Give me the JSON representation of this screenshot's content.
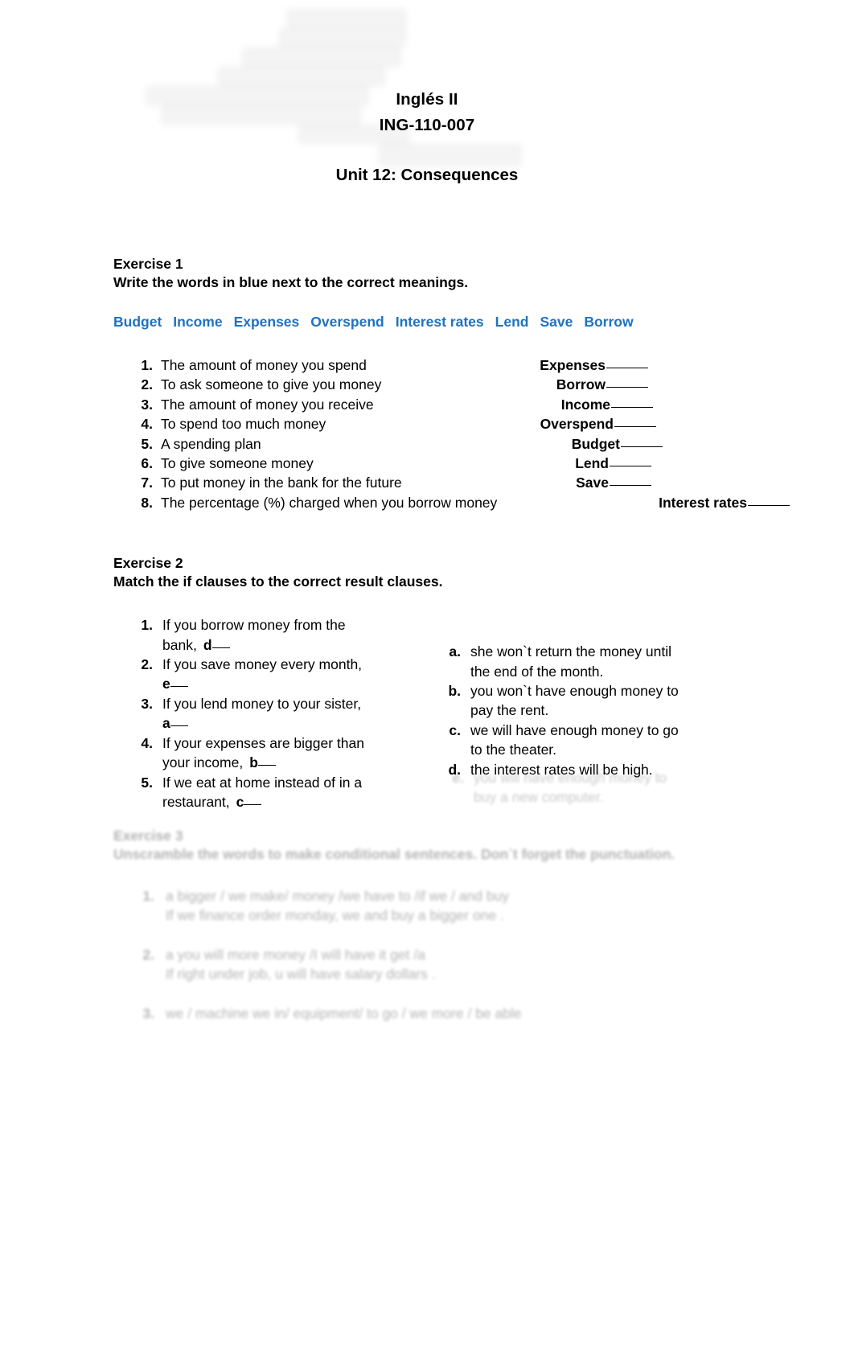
{
  "document": {
    "course_title": "Inglés II",
    "course_code": "ING-110-007",
    "unit_title": "Unit 12: Consequences"
  },
  "colors": {
    "word_bank_blue": "#1F72C0",
    "text_black": "#000000",
    "page_background": "#FFFFFF"
  },
  "exercise1": {
    "heading": "Exercise 1",
    "instructions": "Write the words in blue next to the correct meanings.",
    "word_bank": [
      "Budget",
      "Income",
      "Expenses",
      "Overspend",
      "Interest rates",
      "Lend",
      "Save",
      "Borrow"
    ],
    "items": [
      {
        "number": "1.",
        "definition": "The amount of money you spend",
        "answer": "Expenses"
      },
      {
        "number": "2.",
        "definition": "To ask someone to give you money",
        "answer": "Borrow"
      },
      {
        "number": "3.",
        "definition": "The amount of money you receive",
        "answer": "Income"
      },
      {
        "number": "4.",
        "definition": "To spend too much money",
        "answer": "Overspend"
      },
      {
        "number": "5.",
        "definition": "A spending plan",
        "answer": "Budget"
      },
      {
        "number": "6.",
        "definition": "To give someone money",
        "answer": "Lend"
      },
      {
        "number": "7.",
        "definition": "To put money in the bank for the future",
        "answer": "Save"
      },
      {
        "number": "8.",
        "definition": "The percentage (%) charged when you borrow money",
        "answer": "Interest rates"
      }
    ]
  },
  "exercise2": {
    "heading": "Exercise 2",
    "instructions": "Match the if clauses to the correct result clauses.",
    "if_clauses": [
      {
        "number": "1.",
        "line1": "If you borrow money from the",
        "line2": "bank,",
        "answer": "d"
      },
      {
        "number": "2.",
        "line1": "If you save money every month,",
        "line2": "",
        "answer": "e"
      },
      {
        "number": "3.",
        "line1": "If you lend money to your sister,",
        "line2": "",
        "answer": "a"
      },
      {
        "number": "4.",
        "line1": "If your expenses are bigger than",
        "line2": "your income,",
        "answer": "b"
      },
      {
        "number": "5.",
        "line1": "If we eat at home instead of in a",
        "line2": "restaurant,",
        "answer": "c"
      }
    ],
    "result_clauses": [
      {
        "letter": "a.",
        "line1": "she won`t return the money until",
        "line2": "the end of the month."
      },
      {
        "letter": "b.",
        "line1": "you won`t have enough money to",
        "line2": "pay the rent."
      },
      {
        "letter": "c.",
        "line1": "we will have enough money to go",
        "line2": "to the theater."
      },
      {
        "letter": "d.",
        "line1": "the interest rates will be high.",
        "line2": ""
      },
      {
        "letter": "e.",
        "line1": "you will have enough money to",
        "line2": "buy a new computer."
      }
    ]
  },
  "exercise3": {
    "heading": "Exercise 3",
    "instructions": "Unscramble the words to make conditional sentences. Don`t forget the punctuation.",
    "items": [
      {
        "number": "1.",
        "line1": "a bigger / we make/ money /we have to /if we / and buy",
        "line2": "If we finance order monday, we and buy a bigger one ."
      },
      {
        "number": "2.",
        "line1": "a you will more money /I will have it get /a",
        "line2": "If right under job, u will have salary dollars ."
      },
      {
        "number": "3.",
        "line1": "we / machine we in/ equipment/ to go / we more / be able",
        "line2": ""
      }
    ]
  }
}
